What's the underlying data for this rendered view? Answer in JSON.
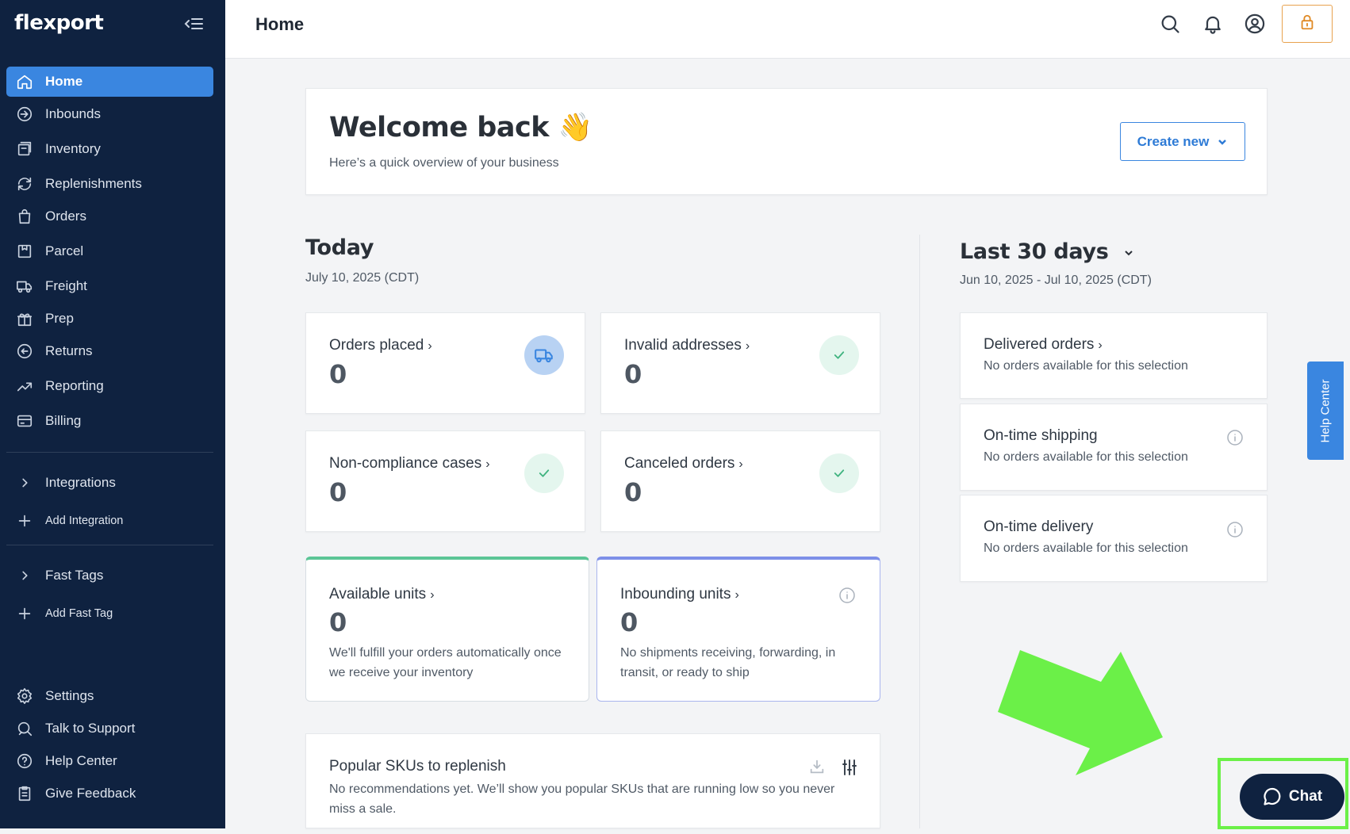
{
  "brand": "flexport",
  "sidebar": {
    "items": [
      {
        "label": "Home",
        "icon": "home-icon"
      },
      {
        "label": "Inbounds",
        "icon": "inbounds-icon"
      },
      {
        "label": "Inventory",
        "icon": "inventory-icon"
      },
      {
        "label": "Replenishments",
        "icon": "refresh-icon"
      },
      {
        "label": "Orders",
        "icon": "shopping-bag-icon"
      },
      {
        "label": "Parcel",
        "icon": "parcel-icon"
      },
      {
        "label": "Freight",
        "icon": "truck-icon"
      },
      {
        "label": "Prep",
        "icon": "gift-icon"
      },
      {
        "label": "Returns",
        "icon": "return-icon"
      },
      {
        "label": "Reporting",
        "icon": "trend-icon"
      },
      {
        "label": "Billing",
        "icon": "credit-card-icon"
      }
    ],
    "integrations": "Integrations",
    "add_integration": "Add Integration",
    "fast_tags": "Fast Tags",
    "add_fast_tag": "Add Fast Tag",
    "bottom": [
      {
        "label": "Settings",
        "icon": "gear-icon"
      },
      {
        "label": "Talk to Support",
        "icon": "support-icon"
      },
      {
        "label": "Help Center",
        "icon": "help-circle-icon"
      },
      {
        "label": "Give Feedback",
        "icon": "clipboard-icon"
      }
    ]
  },
  "header": {
    "title": "Home"
  },
  "welcome": {
    "title": "Welcome back 👋",
    "subtitle": "Here’s a quick overview of your business",
    "create_button": "Create new"
  },
  "today": {
    "title": "Today",
    "date": "July 10, 2025 (CDT)",
    "stats": [
      {
        "label": "Orders placed",
        "value": "0"
      },
      {
        "label": "Invalid addresses",
        "value": "0"
      },
      {
        "label": "Non-compliance cases",
        "value": "0"
      },
      {
        "label": "Canceled orders",
        "value": "0"
      }
    ],
    "available": {
      "label": "Available units",
      "value": "0",
      "desc": "We'll fulfill your orders automatically once we receive your inventory"
    },
    "inbounding": {
      "label": "Inbounding units",
      "value": "0",
      "desc": "No shipments receiving, forwarding, in transit, or ready to ship"
    }
  },
  "popular": {
    "title": "Popular SKUs to replenish",
    "desc": "No recommendations yet. We’ll show you popular SKUs that are running low so you never miss a sale."
  },
  "last30": {
    "title": "Last 30 days",
    "range": "Jun 10, 2025 - Jul 10, 2025 (CDT)",
    "cards": [
      {
        "title": "Delivered orders",
        "sub": "No orders available for this selection"
      },
      {
        "title": "On-time shipping",
        "sub": "No orders available for this selection"
      },
      {
        "title": "On-time delivery",
        "sub": "No orders available for this selection"
      }
    ]
  },
  "help_tab": "Help Center",
  "chat": "Chat",
  "colors": {
    "sidebar": "#0f2240",
    "accent": "#3a86e0",
    "annotation": "#6bf048",
    "available_border": "#5bc596",
    "inbounding_border": "#7d8fe8"
  }
}
